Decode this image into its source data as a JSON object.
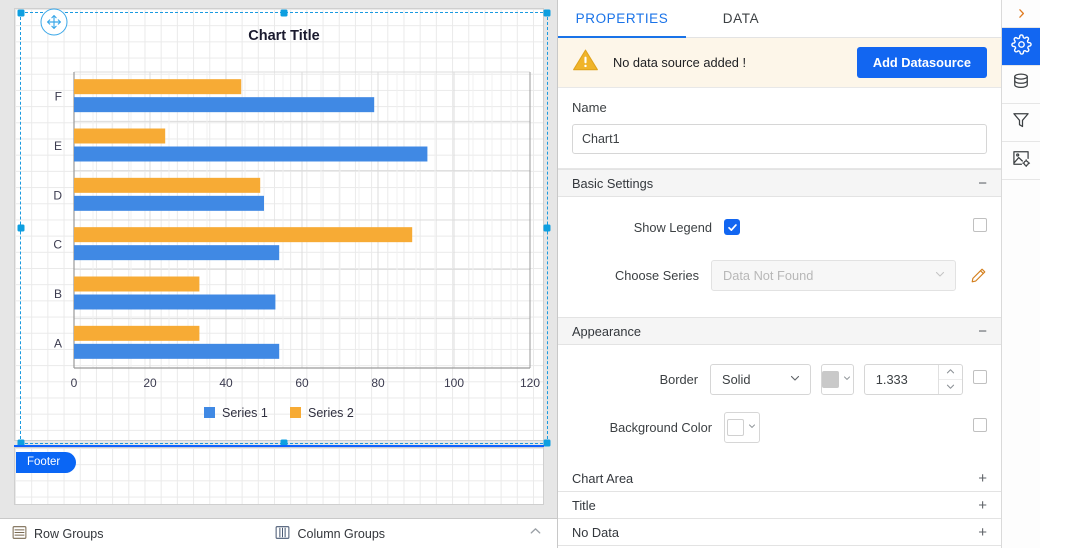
{
  "designer": {
    "footer_tab_label": "Footer",
    "move_handle": "move-handle",
    "groups_bar": {
      "row_groups_label": "Row Groups",
      "column_groups_label": "Column Groups",
      "collapse_icon": "chevron-up-icon"
    }
  },
  "chart_data": {
    "type": "bar",
    "orientation": "horizontal",
    "title": "Chart Title",
    "categories": [
      "A",
      "B",
      "C",
      "D",
      "E",
      "F"
    ],
    "series": [
      {
        "name": "Series 1",
        "color": "#4089e4",
        "values": [
          54,
          53,
          54,
          50,
          93,
          79
        ]
      },
      {
        "name": "Series 2",
        "color": "#f7ab35",
        "values": [
          33,
          33,
          89,
          49,
          24,
          44
        ]
      }
    ],
    "xlabel": "",
    "ylabel": "",
    "xlim": [
      0,
      120
    ],
    "xticks": [
      0,
      20,
      40,
      60,
      80,
      100,
      120
    ],
    "xtick_labels": [
      "0",
      "20",
      "40",
      "60",
      "80",
      "100",
      "120"
    ],
    "grid": true,
    "legend": true,
    "legend_position": "bottom"
  },
  "panel": {
    "tabs": [
      {
        "label": "PROPERTIES",
        "active": true
      },
      {
        "label": "DATA",
        "active": false
      }
    ],
    "datasource_banner": {
      "warning_icon": "warning-triangle-icon",
      "message": "No data source added !",
      "button_label": "Add Datasource"
    },
    "name_section": {
      "label": "Name",
      "value": "Chart1",
      "placeholder": "Name"
    },
    "basic_settings": {
      "title": "Basic Settings",
      "toggle_sign": "−",
      "show_legend": {
        "label": "Show Legend",
        "checked": true,
        "expr_checkbox": false
      },
      "choose_series": {
        "label": "Choose Series",
        "value": "Data Not Found",
        "disabled": true,
        "edit_icon": "pencil-icon"
      }
    },
    "appearance": {
      "title": "Appearance",
      "toggle_sign": "−",
      "border": {
        "label": "Border",
        "style": "Solid",
        "color": "#c9c9c9",
        "width": "1.333",
        "expr_checkbox": false
      },
      "background_color": {
        "label": "Background Color",
        "color": "#ffffff",
        "expr_checkbox": false
      }
    },
    "collapsed_sections": [
      {
        "label": "Chart Area",
        "sign": "+"
      },
      {
        "label": "Title",
        "sign": "+"
      },
      {
        "label": "No Data",
        "sign": "+"
      }
    ]
  },
  "rail": {
    "items": [
      {
        "icon": "chevron-right-icon",
        "active": false
      },
      {
        "icon": "gear-icon",
        "active": true
      },
      {
        "icon": "database-icon",
        "active": false
      },
      {
        "icon": "filter-icon",
        "active": false
      },
      {
        "icon": "image-settings-icon",
        "active": false
      }
    ]
  },
  "colors": {
    "accent": "#1266f1",
    "series1": "#4089e4",
    "series2": "#f7ab35",
    "warning": "#f0b429",
    "banner_bg": "#fdf6e9"
  }
}
